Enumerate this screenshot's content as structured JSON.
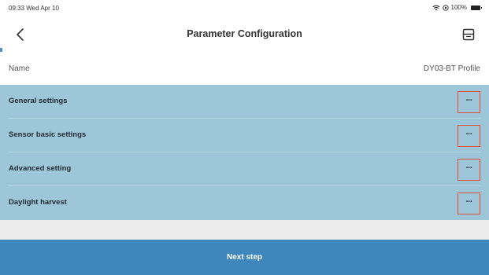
{
  "status_bar": {
    "time_date": "09:33  Wed Apr 10",
    "battery_text": "100%",
    "icons": [
      "wifi-icon",
      "location-icon",
      "battery-icon"
    ]
  },
  "nav": {
    "title": "Parameter Configuration",
    "back_icon": "chevron-left-icon",
    "save_icon": "save-icon"
  },
  "name_row": {
    "label": "Name",
    "value": "DY03-BT Profile"
  },
  "settings": [
    {
      "label": "General settings",
      "more": "···"
    },
    {
      "label": "Sensor basic settings",
      "more": "···"
    },
    {
      "label": "Advanced setting",
      "more": "···"
    },
    {
      "label": "Daylight harvest",
      "more": "···"
    }
  ],
  "footer": {
    "next_label": "Next step"
  },
  "colors": {
    "section_bg": "#9ec6d9",
    "button_bg": "#3f86bd",
    "highlight_border": "#e0533a"
  }
}
